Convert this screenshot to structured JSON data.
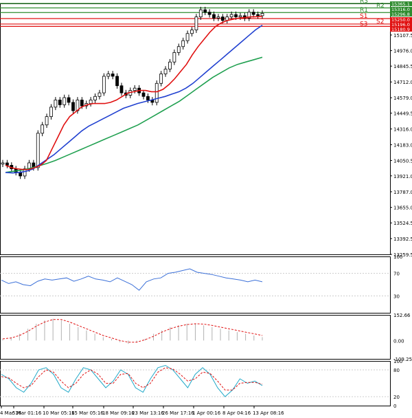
{
  "colors": {
    "background": "#ffffff",
    "frame": "#000000",
    "bull_candle": "#000000",
    "bear_candle": "#000000",
    "ma_fast": "#e01010",
    "ma_mid": "#2040d0",
    "ma_slow": "#20a050",
    "resistance": "#2e8b2e",
    "support": "#e01010",
    "rsi": "#3a6fd8",
    "macd_hist": "#b0b0b0",
    "macd_signal": "#e01010",
    "stoch_main": "#20a8c8",
    "stoch_signal": "#e01010",
    "level_green_label_bg": "#2e8b2e",
    "level_red_label_bg": "#e01010"
  },
  "chart_data": [
    {
      "type": "candlestick",
      "title": "",
      "y_ticks": [
        "13259.5",
        "13392.5",
        "13524.5",
        "13655.0",
        "13787.0",
        "13921.0",
        "14050.5",
        "14183.0",
        "14316.0",
        "14449.5",
        "14579.0",
        "14712.0",
        "14845.5",
        "14976.0",
        "15107.5",
        "15240.0",
        "15373.5"
      ],
      "ylim": [
        13259.5,
        15373.5
      ],
      "x_ticks": [
        "4 Mar 16",
        "5 Mar 01:16",
        "10 Mar 05:16",
        "15 Mar 05:16",
        "18 Mar 09:16",
        "23 Mar 13:16",
        "26 Mar 17:16",
        "1 Apr 00:16",
        "8 Apr 04:16",
        "13 Apr 08:16"
      ],
      "pivot_levels": [
        {
          "name": "R3",
          "value": 15373.5,
          "color": "green"
        },
        {
          "name": "R2",
          "value": 15336.0,
          "color": "green"
        },
        {
          "name": "R1",
          "value": 15296.8,
          "color": "green"
        },
        {
          "name": "S1",
          "value": 15246.0,
          "color": "red"
        },
        {
          "name": "S2",
          "value": 15200.0,
          "color": "red"
        },
        {
          "name": "S3",
          "value": 15180.0,
          "color": "red"
        }
      ],
      "price_labels": [
        "15365.1",
        "15316.0",
        "15296.8",
        "15250.0",
        "15196.0",
        "15180.9"
      ],
      "ohlc_close_path": [
        14030,
        14010,
        13980,
        13950,
        13920,
        13980,
        14030,
        13990,
        14280,
        14350,
        14420,
        14500,
        14560,
        14520,
        14580,
        14540,
        14470,
        14560,
        14510,
        14530,
        14560,
        14590,
        14620,
        14760,
        14780,
        14760,
        14680,
        14620,
        14600,
        14640,
        14660,
        14620,
        14590,
        14560,
        14540,
        14700,
        14780,
        14820,
        14880,
        14960,
        15010,
        15060,
        15120,
        15150,
        15260,
        15320,
        15300,
        15280,
        15250,
        15260,
        15230,
        15260,
        15280,
        15260,
        15270,
        15250,
        15300,
        15280,
        15270,
        15290
      ],
      "ma_fast_path": [
        14010,
        13990,
        13980,
        13975,
        13975,
        13990,
        14010,
        14050,
        14150,
        14250,
        14350,
        14420,
        14460,
        14500,
        14520,
        14530,
        14530,
        14530,
        14540,
        14560,
        14590,
        14620,
        14630,
        14640,
        14640,
        14630,
        14630,
        14650,
        14690,
        14740,
        14800,
        14860,
        14940,
        15010,
        15070,
        15130,
        15180,
        15210,
        15230,
        15240,
        15250,
        15255,
        15260,
        15262,
        15265
      ],
      "ma_mid_path": [
        13950,
        13945,
        13950,
        13960,
        13980,
        14020,
        14060,
        14100,
        14150,
        14200,
        14250,
        14300,
        14340,
        14370,
        14400,
        14430,
        14460,
        14490,
        14510,
        14530,
        14545,
        14560,
        14575,
        14590,
        14610,
        14630,
        14660,
        14700,
        14750,
        14800,
        14850,
        14900,
        14950,
        15000,
        15050,
        15100,
        15150,
        15190
      ],
      "ma_slow_path": [
        13950,
        13960,
        13970,
        13985,
        14005,
        14025,
        14050,
        14080,
        14110,
        14140,
        14170,
        14200,
        14230,
        14260,
        14290,
        14320,
        14350,
        14390,
        14430,
        14470,
        14510,
        14550,
        14600,
        14650,
        14700,
        14750,
        14790,
        14830,
        14860,
        14880,
        14900,
        14920
      ]
    },
    {
      "type": "line",
      "title": "",
      "y_ticks": [
        "100",
        "70",
        "30",
        "0"
      ],
      "ylim": [
        0,
        100
      ],
      "series": [
        {
          "values": [
            58,
            52,
            55,
            50,
            48,
            56,
            60,
            58,
            60,
            62,
            56,
            60,
            65,
            60,
            58,
            55,
            62,
            56,
            50,
            40,
            55,
            60,
            62,
            70,
            72,
            75,
            78,
            72,
            70,
            68,
            65,
            62,
            60,
            58,
            55,
            58,
            55
          ]
        }
      ]
    },
    {
      "type": "bar",
      "title": "",
      "y_ticks": [
        "152.66",
        "0.00",
        "-109.25"
      ],
      "ylim": [
        -109.25,
        152.66
      ],
      "histogram": [
        10,
        20,
        40,
        70,
        100,
        120,
        130,
        120,
        100,
        80,
        60,
        40,
        20,
        10,
        -10,
        -20,
        -10,
        10,
        40,
        60,
        80,
        90,
        100,
        100,
        90,
        80,
        70,
        60,
        50,
        40,
        30,
        20
      ],
      "signal_path": [
        10,
        15,
        30,
        55,
        85,
        110,
        125,
        125,
        110,
        90,
        70,
        50,
        30,
        15,
        0,
        -10,
        -10,
        5,
        25,
        50,
        70,
        85,
        95,
        100,
        98,
        90,
        80,
        70,
        60,
        50,
        40,
        30
      ]
    },
    {
      "type": "line",
      "title": "",
      "y_ticks": [
        "100",
        "80",
        "20",
        "0"
      ],
      "ylim": [
        0,
        100
      ],
      "series": [
        {
          "values": [
            70,
            60,
            40,
            30,
            50,
            80,
            85,
            70,
            40,
            30,
            60,
            85,
            80,
            60,
            40,
            55,
            80,
            70,
            40,
            30,
            60,
            85,
            90,
            80,
            60,
            40,
            70,
            85,
            70,
            40,
            20,
            35,
            60,
            50,
            55,
            45
          ]
        },
        {
          "values": [
            65,
            62,
            50,
            40,
            45,
            65,
            80,
            75,
            55,
            40,
            50,
            70,
            80,
            70,
            50,
            50,
            70,
            72,
            50,
            40,
            50,
            75,
            85,
            82,
            70,
            55,
            60,
            75,
            72,
            55,
            35,
            35,
            50,
            52,
            52,
            48
          ]
        }
      ]
    }
  ]
}
